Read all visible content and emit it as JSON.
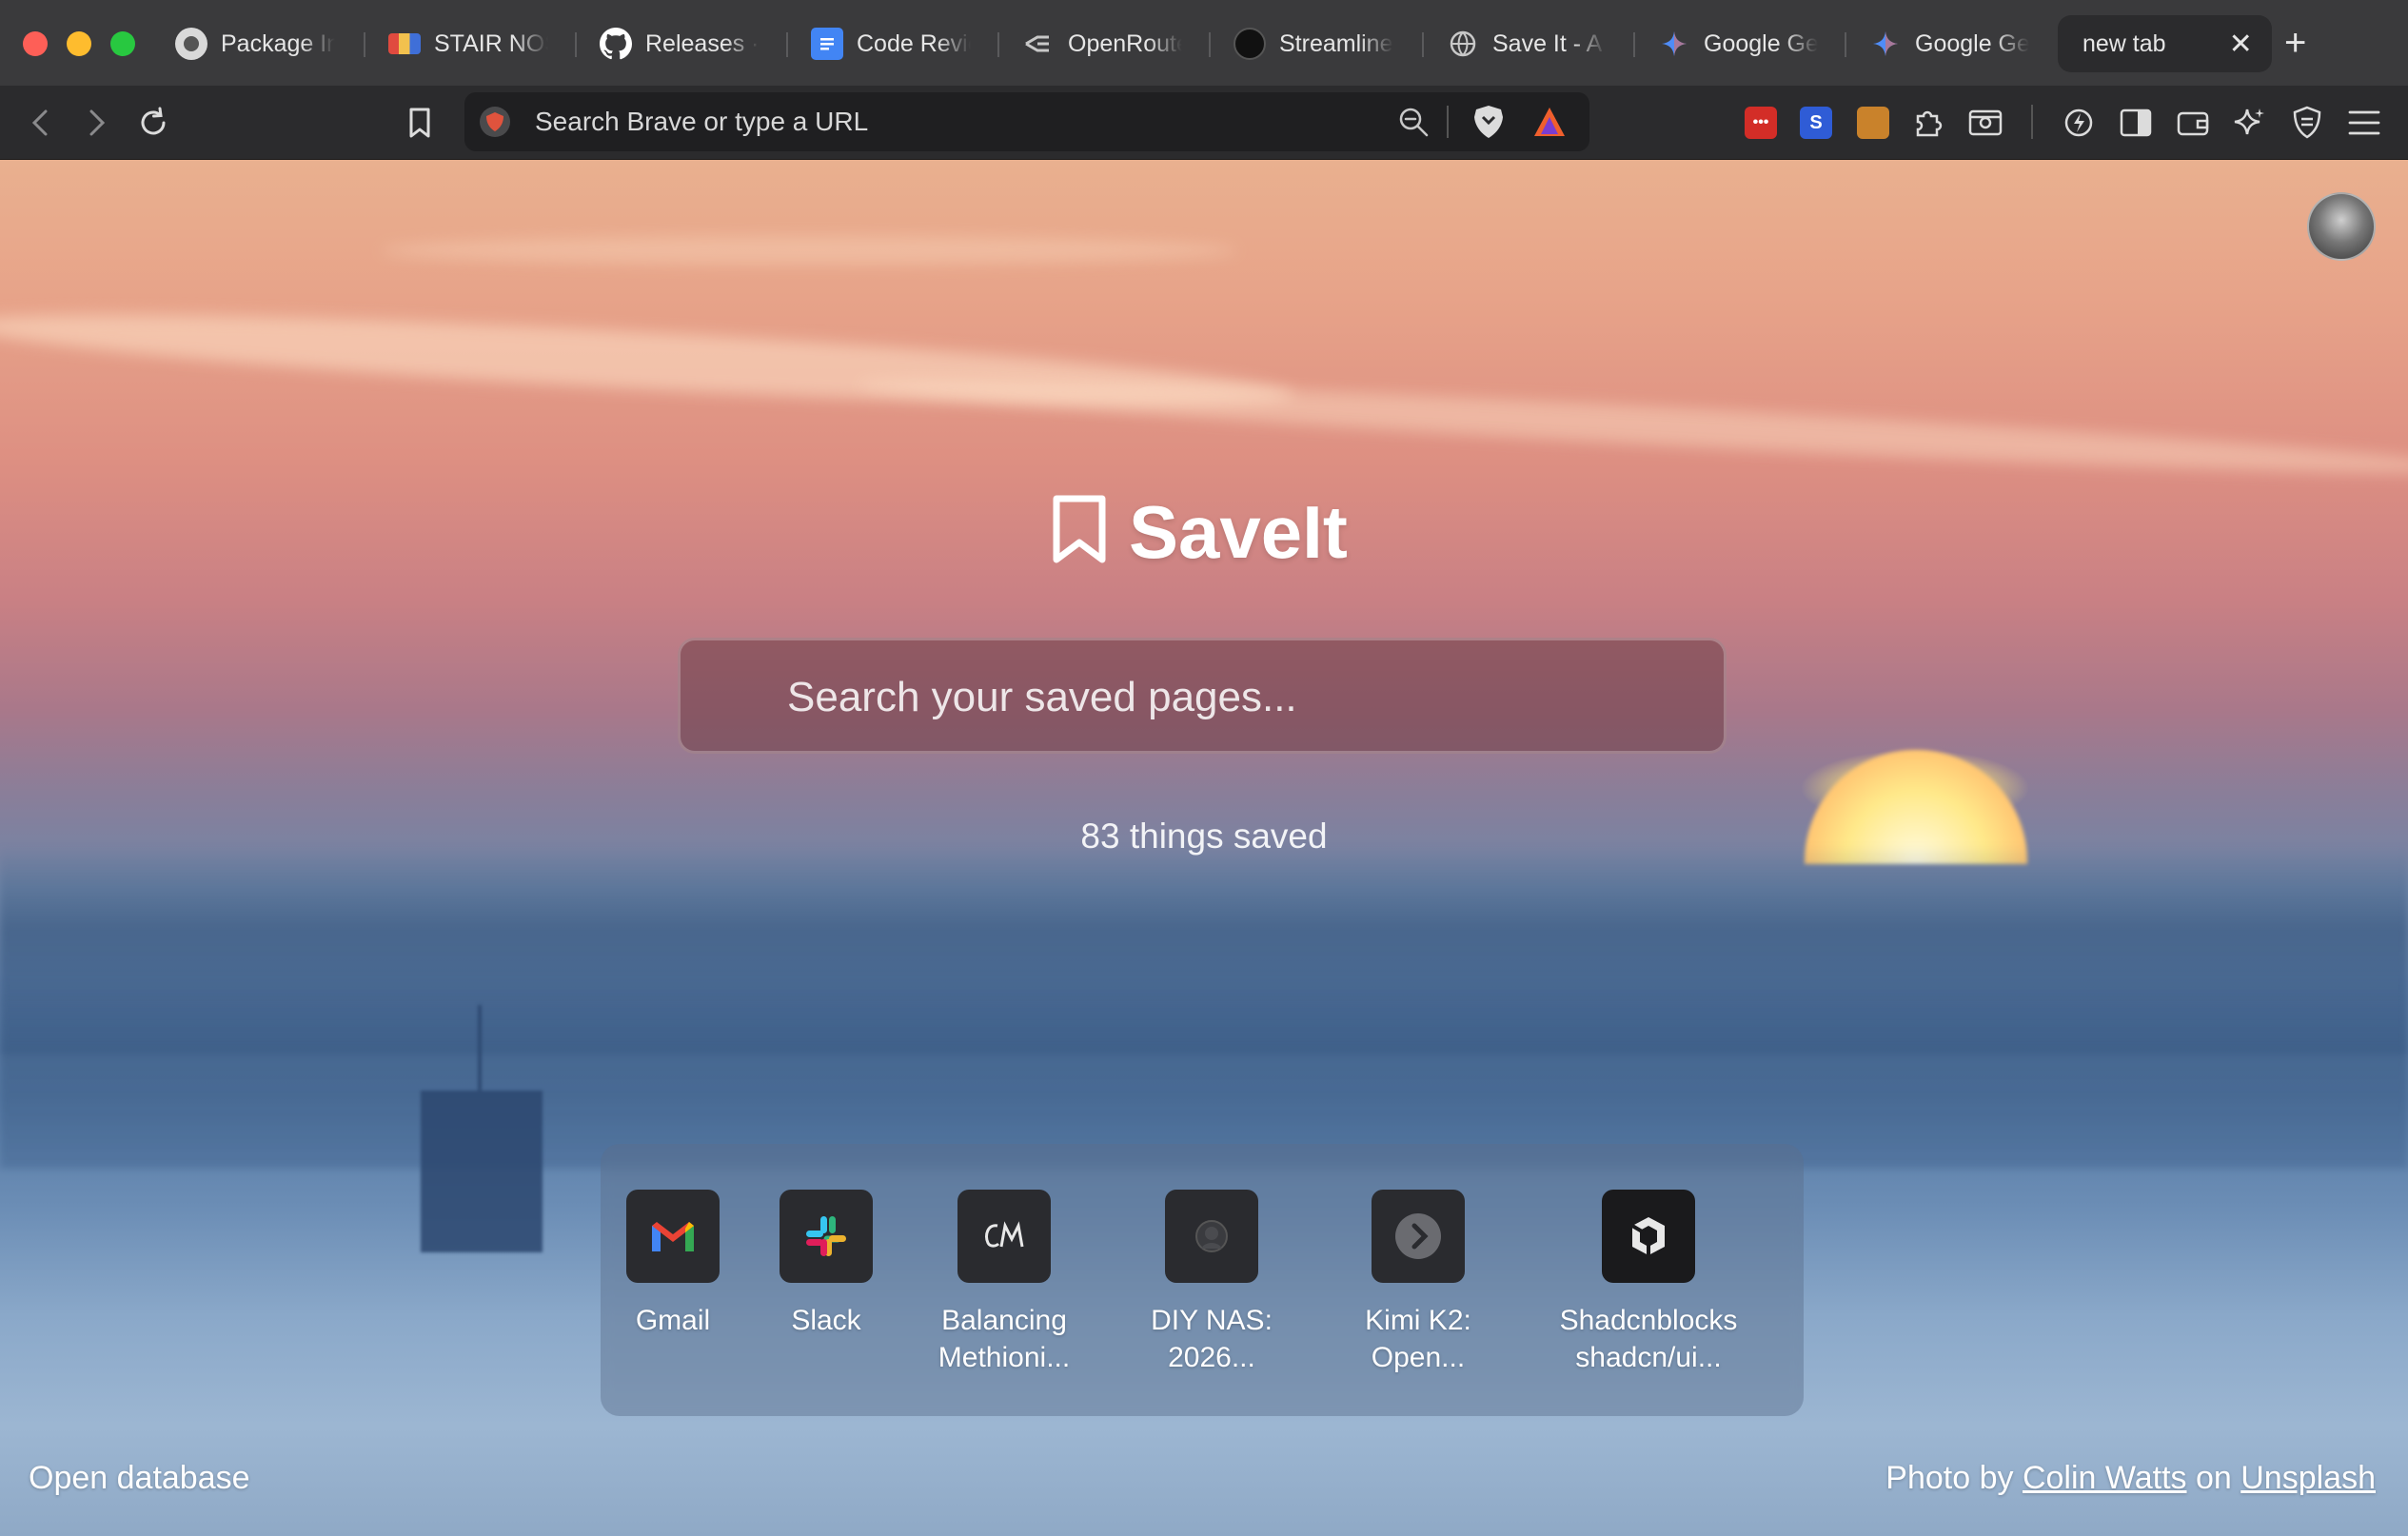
{
  "tabs": [
    {
      "label": "Package In",
      "icon": "package-favicon-icon",
      "color": "#d0d0d0"
    },
    {
      "label": "STAIR NOS",
      "icon": "stair-favicon-icon",
      "color": "#e04a3f"
    },
    {
      "label": "Releases ·",
      "icon": "github-icon",
      "color": "#ffffff"
    },
    {
      "label": "Code Revie",
      "icon": "docs-icon",
      "color": "#4285f4"
    },
    {
      "label": "OpenRoute",
      "icon": "openrouter-icon",
      "color": "#c8c8c8"
    },
    {
      "label": "Streamline",
      "icon": "streamline-icon",
      "color": "#111111"
    },
    {
      "label": "Save It - A",
      "icon": "globe-icon",
      "color": "#c8c8c8"
    },
    {
      "label": "Google Ge",
      "icon": "gemini-icon",
      "color": "#4f8cf7"
    },
    {
      "label": "Google Ge",
      "icon": "gemini-icon",
      "color": "#4f8cf7"
    }
  ],
  "active_tab": {
    "label": "new tab"
  },
  "urlbar": {
    "placeholder": "Search Brave or type a URL"
  },
  "brand": {
    "title": "SaveIt"
  },
  "search": {
    "placeholder": "Search your saved pages..."
  },
  "saved_count": "83 things saved",
  "shortcuts": [
    {
      "line1": "Gmail",
      "line2": "",
      "icon": "gmail-icon"
    },
    {
      "line1": "Slack",
      "line2": "",
      "icon": "slack-icon"
    },
    {
      "line1": "Balancing",
      "line2": "Methioni...",
      "icon": "cm-logo-icon"
    },
    {
      "line1": "DIY NAS:",
      "line2": "2026...",
      "icon": "nas-icon"
    },
    {
      "line1": "Kimi K2:",
      "line2": "Open...",
      "icon": "chevron-right-icon"
    },
    {
      "line1": "Shadcnblocks",
      "line2": "shadcn/ui...",
      "icon": "shadcnblocks-icon"
    }
  ],
  "footer": {
    "open_db": "Open database",
    "credit_prefix": "Photo by",
    "photographer": "Colin Watts",
    "credit_mid": "on",
    "source": "Unsplash"
  }
}
